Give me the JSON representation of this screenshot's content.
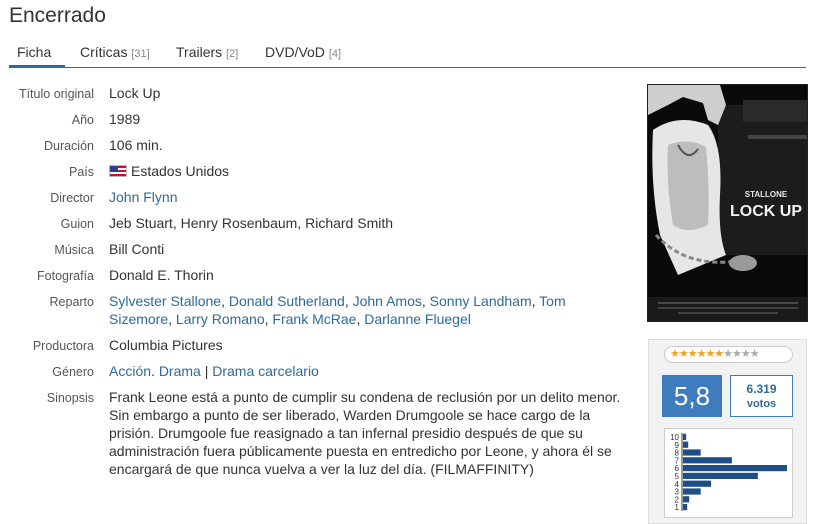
{
  "page": {
    "title": "Encerrado"
  },
  "tabs": [
    {
      "label": "Ficha",
      "count": ""
    },
    {
      "label": "Críticas",
      "count": "[31]"
    },
    {
      "label": "Trailers",
      "count": "[2]"
    },
    {
      "label": "DVD/VoD",
      "count": "[4]"
    }
  ],
  "info": {
    "original_title": {
      "label": "Título original",
      "value": "Lock Up"
    },
    "year": {
      "label": "Año",
      "value": "1989"
    },
    "duration": {
      "label": "Duración",
      "value": "106 min."
    },
    "country": {
      "label": "País",
      "value": "Estados Unidos"
    },
    "director": {
      "label": "Director",
      "value": "John Flynn"
    },
    "screenplay": {
      "label": "Guion",
      "value": "Jeb Stuart, Henry Rosenbaum, Richard Smith"
    },
    "music": {
      "label": "Música",
      "value": "Bill Conti"
    },
    "photography": {
      "label": "Fotografía",
      "value": "Donald E. Thorin"
    },
    "cast": {
      "label": "Reparto",
      "members": [
        "Sylvester Stallone",
        "Donald Sutherland",
        "John Amos",
        "Sonny Landham",
        "Tom Sizemore",
        "Larry Romano",
        "Frank McRae",
        "Darlanne Fluegel"
      ]
    },
    "producer": {
      "label": "Productora",
      "value": "Columbia Pictures"
    },
    "genre": {
      "label": "Género",
      "tags": [
        "Acción",
        "Drama"
      ],
      "subgenre": "Drama carcelario"
    },
    "synopsis": {
      "label": "Sinopsis",
      "value": "Frank Leone está a punto de cumplir su condena de reclusión por un delito menor. Sin embargo a punto de ser liberado, Warden Drumgoole se hace cargo de la prisión. Drumgoole fue reasignado a tan infernal presidio después de que su administración fuera públicamente puesta en entredicho por Leone, y ahora él se encargará de que nunca vuelva a ver la luz del día. (FILMAFFINITY)"
    }
  },
  "poster": {
    "star_name": "STALLONE",
    "movie_name": "LOCK UP"
  },
  "rating": {
    "average": "5,8",
    "votes_count": "6.319",
    "votes_label": "votos",
    "stars_on": 6,
    "stars_total": 10,
    "histogram": {
      "labels": [
        "10",
        "9",
        "8",
        "7",
        "6",
        "5",
        "4",
        "3",
        "2",
        "1"
      ],
      "values": [
        3,
        5,
        17,
        47,
        100,
        72,
        27,
        17,
        6,
        4
      ]
    }
  },
  "colors": {
    "link": "#2d6a99",
    "accent": "#3f7cbd",
    "histogram_bar": "#1d4f86"
  }
}
